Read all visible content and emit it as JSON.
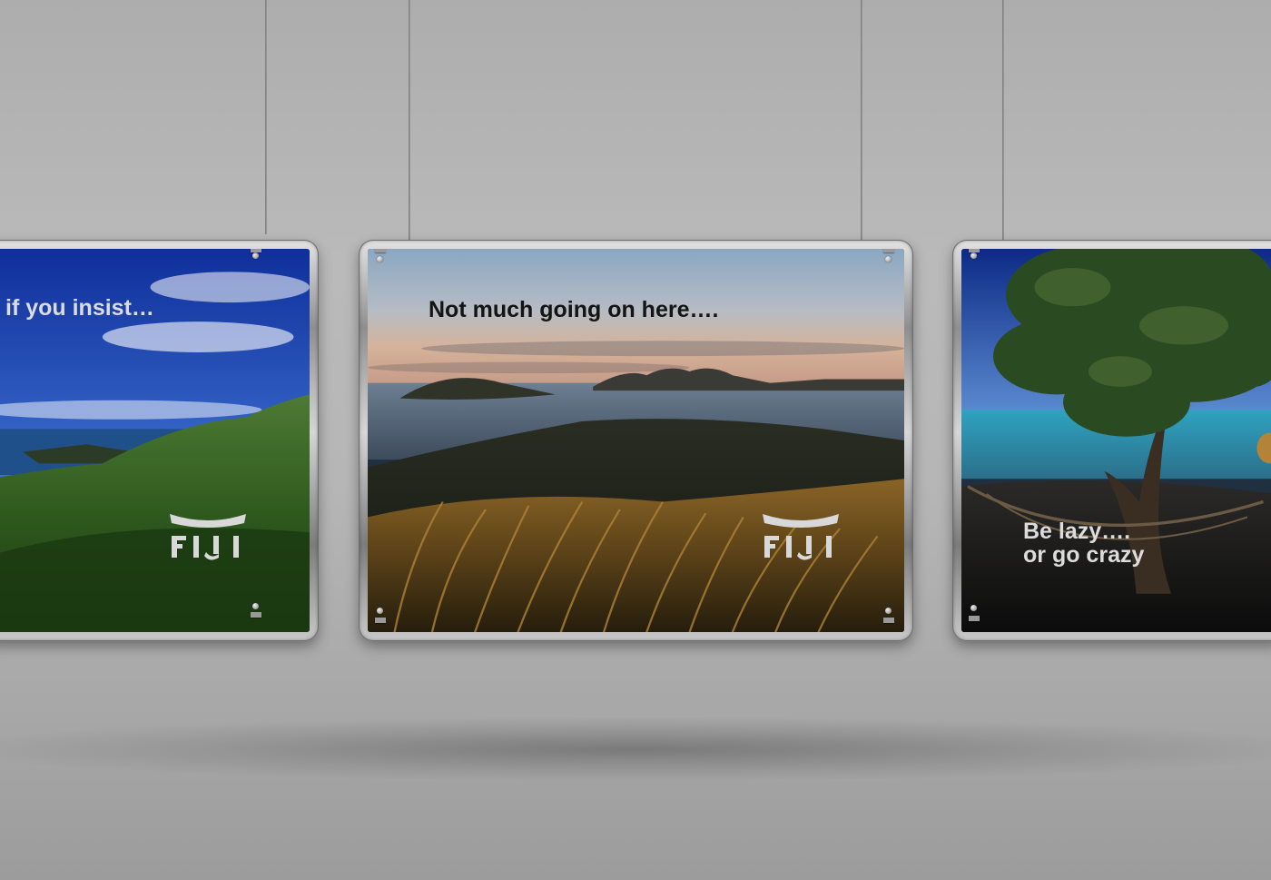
{
  "posters": [
    {
      "headline": "if you insist…",
      "logo_text": "FIJI"
    },
    {
      "headline": "Not much going on here….",
      "logo_text": "FIJI"
    },
    {
      "headline": "Be lazy….\nor go crazy"
    }
  ],
  "colors": {
    "wall": "#b5b5b5",
    "frame_metal": "#b0b0b0",
    "headline_light": "#dcdcdc",
    "headline_dark": "#141414",
    "logo": "#d8d8d8"
  }
}
